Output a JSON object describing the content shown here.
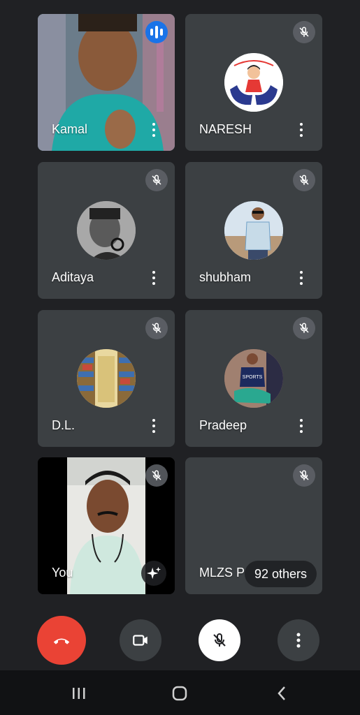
{
  "participants": [
    {
      "name": "Kamal",
      "state": "speaking"
    },
    {
      "name": "NARESH",
      "state": "muted"
    },
    {
      "name": "Aditaya",
      "state": "muted"
    },
    {
      "name": "shubham",
      "state": "muted"
    },
    {
      "name": "D.L.",
      "state": "muted"
    },
    {
      "name": "Pradeep",
      "state": "muted"
    },
    {
      "name": "You",
      "state": "muted"
    },
    {
      "name": "MLZS P",
      "state": "muted"
    }
  ],
  "others_label": "92 others",
  "controls": {
    "end_call": "end-call",
    "camera": "video-camera",
    "mic": "mic-off",
    "more": "more-options"
  },
  "colors": {
    "background": "#202124",
    "tile": "#3c4043",
    "end_call": "#ea4335",
    "speaking": "#1a73e8"
  }
}
